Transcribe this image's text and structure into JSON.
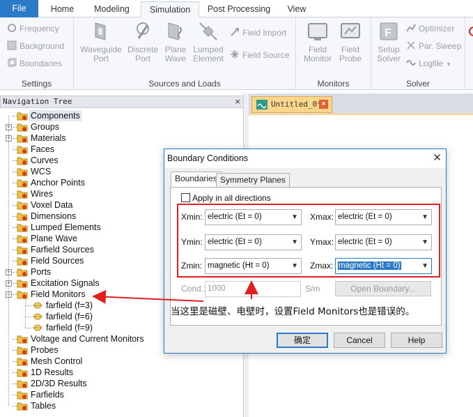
{
  "ribbon": {
    "tabs": [
      "File",
      "Home",
      "Modeling",
      "Simulation",
      "Post Processing",
      "View"
    ],
    "active_tab": "Simulation",
    "groups": {
      "settings": {
        "label": "Settings",
        "items": [
          "Frequency",
          "Background",
          "Boundaries"
        ]
      },
      "sources_loads": {
        "label": "Sources and Loads",
        "big_buttons": [
          {
            "line1": "Waveguide",
            "line2": "Port"
          },
          {
            "line1": "Discrete",
            "line2": "Port"
          },
          {
            "line1": "Plane",
            "line2": "Wave"
          },
          {
            "line1": "Lumped",
            "line2": "Element"
          }
        ],
        "small_buttons": [
          "Field Import",
          "Field Source"
        ]
      },
      "monitors": {
        "label": "Monitors",
        "big_buttons": [
          {
            "line1": "Field",
            "line2": "Monitor"
          },
          {
            "line1": "Field",
            "line2": "Probe"
          }
        ]
      },
      "solver": {
        "label": "Solver",
        "big_buttons": [
          {
            "line1": "Setup",
            "line2": "Solver"
          }
        ],
        "small_buttons": [
          "Optimizer",
          "Par. Sweep",
          "Logfile"
        ]
      }
    }
  },
  "nav": {
    "title": "Navigation Tree",
    "close": "×",
    "items": [
      {
        "label": "Components",
        "expand": false,
        "selected": true
      },
      {
        "label": "Groups",
        "expand": true
      },
      {
        "label": "Materials",
        "expand": true
      },
      {
        "label": "Faces",
        "expand": false
      },
      {
        "label": "Curves",
        "expand": false
      },
      {
        "label": "WCS",
        "expand": false
      },
      {
        "label": "Anchor Points",
        "expand": false
      },
      {
        "label": "Wires",
        "expand": false
      },
      {
        "label": "Voxel Data",
        "expand": false
      },
      {
        "label": "Dimensions",
        "expand": false
      },
      {
        "label": "Lumped Elements",
        "expand": false
      },
      {
        "label": "Plane Wave",
        "expand": false
      },
      {
        "label": "Farfield Sources",
        "expand": false
      },
      {
        "label": "Field Sources",
        "expand": false
      },
      {
        "label": "Ports",
        "expand": true
      },
      {
        "label": "Excitation Signals",
        "expand": true
      },
      {
        "label": "Field Monitors",
        "expand": "open"
      },
      {
        "label": "farfield (f=3)",
        "child": true
      },
      {
        "label": "farfield (f=6)",
        "child": true
      },
      {
        "label": "farfield (f=9)",
        "child": true
      },
      {
        "label": "Voltage and Current Monitors",
        "expand": false
      },
      {
        "label": "Probes",
        "expand": false
      },
      {
        "label": "Mesh Control",
        "expand": false
      },
      {
        "label": "1D Results",
        "expand": false
      },
      {
        "label": "2D/3D Results",
        "expand": false
      },
      {
        "label": "Farfields",
        "expand": false
      },
      {
        "label": "Tables",
        "expand": false
      }
    ]
  },
  "editor": {
    "doc_tab": "Untitled_0*",
    "doc_close": "×"
  },
  "dialog": {
    "title": "Boundary Conditions",
    "close": "✕",
    "tabs": [
      "Boundaries",
      "Symmetry Planes"
    ],
    "apply_all": "Apply in all directions",
    "fields": {
      "xmin_label": "Xmin:",
      "xmin_value": "electric (Et = 0)",
      "xmax_label": "Xmax:",
      "xmax_value": "electric (Et = 0)",
      "ymin_label": "Ymin:",
      "ymin_value": "electric (Et = 0)",
      "ymax_label": "Ymax:",
      "ymax_value": "electric (Et = 0)",
      "zmin_label": "Zmin:",
      "zmin_value": "magnetic (Ht = 0)",
      "zmax_label": "Zmax:",
      "zmax_value": "magnetic (Ht = 0)"
    },
    "cond_label": "Cond.:",
    "cond_value": "1000",
    "cond_unit": "S/m",
    "open_boundary": "Open Boundary...",
    "ok": "确定",
    "cancel": "Cancel",
    "help": "Help"
  },
  "annotation": "当这里是磁壁、电壁时，设置Field Monitors也是错误的。",
  "colors": {
    "accent": "#2b79c9",
    "annotation_red": "#e02020",
    "tab_orange": "#fbd58c"
  }
}
